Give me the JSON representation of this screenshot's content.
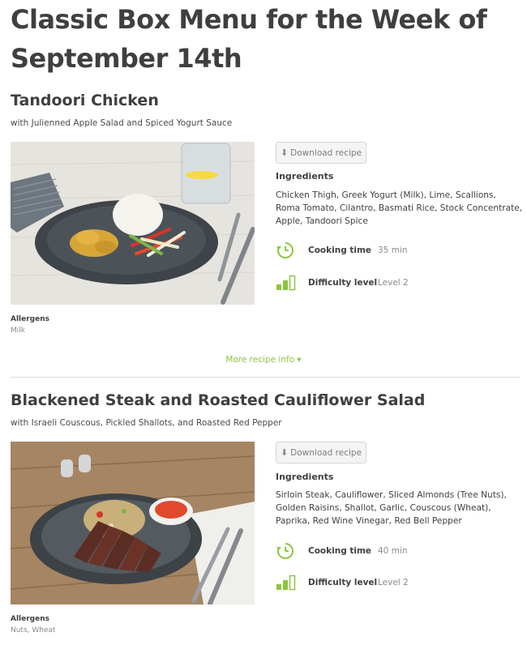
{
  "page": {
    "title": "Classic Box Menu for the Week of September 14th"
  },
  "labels": {
    "download": "Download recipe",
    "ingredients": "Ingredients",
    "cooking_time": "Cooking time",
    "difficulty": "Difficulty level",
    "allergens": "Allergens",
    "more_info": "More recipe info ▾"
  },
  "colors": {
    "accent": "#8dc63f",
    "text": "#3f3f3f",
    "muted": "#8a8a8a"
  },
  "icons": {
    "download": "download-icon",
    "clock": "clock-icon",
    "difficulty": "difficulty-bars-icon",
    "dropdown": "chevron-down-icon"
  },
  "recipes": [
    {
      "title": "Tandoori Chicken",
      "subtitle": "with Julienned Apple Salad and Spiced Yogurt Sauce",
      "ingredients": "Chicken Thigh, Greek Yogurt (Milk), Lime, Scallions, Roma Tomato, Cilantro, Basmati Rice, Stock Concentrate, Apple, Tandoori Spice",
      "cooking_time": "35 min",
      "difficulty": "Level 2",
      "difficulty_level": 2,
      "allergens": "Milk"
    },
    {
      "title": "Blackened Steak and Roasted Cauliflower Salad",
      "subtitle": "with Israeli Couscous, Pickled Shallots, and Roasted Red Pepper",
      "ingredients": "Sirloin Steak, Cauliflower, Sliced Almonds (Tree Nuts), Golden Raisins, Shallot, Garlic, Couscous (Wheat), Paprika, Red Wine Vinegar, Red Bell Pepper",
      "cooking_time": "40 min",
      "difficulty": "Level 2",
      "difficulty_level": 2,
      "allergens": "Nuts, Wheat"
    }
  ]
}
